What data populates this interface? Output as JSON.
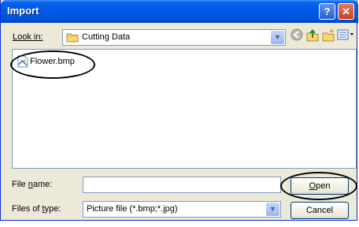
{
  "window": {
    "title": "Import"
  },
  "title_buttons": {
    "help": "?",
    "close": "✕"
  },
  "look_in": {
    "label_pre": "",
    "label_ul": "L",
    "label_post": "ook in:",
    "value": "Cutting Data"
  },
  "toolbar": {
    "back_icon": "back-icon",
    "up_icon": "up-folder-icon",
    "new_folder_icon": "new-folder-icon",
    "views_icon": "views-menu-icon"
  },
  "files": [
    {
      "name": "Flower.bmp",
      "icon": "bitmap-file-icon"
    }
  ],
  "file_name": {
    "label_pre": "File ",
    "label_ul": "n",
    "label_post": "ame:",
    "value": ""
  },
  "files_of_type": {
    "label_pre": "Files of ",
    "label_ul": "t",
    "label_post": "ype:",
    "value": "Picture file (*.bmp;*.jpg)"
  },
  "buttons": {
    "open": {
      "ul": "O",
      "rest": "pen"
    },
    "cancel": "Cancel"
  }
}
